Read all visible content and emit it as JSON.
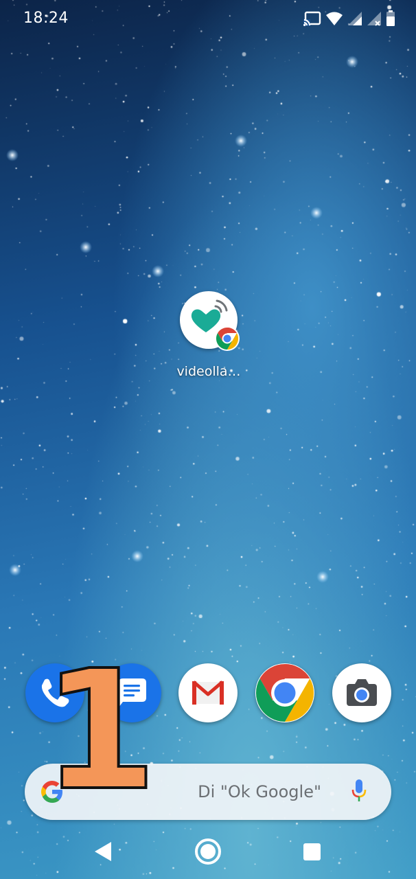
{
  "status_bar": {
    "time": "18:24",
    "icons": [
      "cast-icon",
      "wifi-icon",
      "signal-icon",
      "signal-no-service-icon",
      "battery-icon"
    ]
  },
  "home": {
    "app_shortcut": {
      "label": "videolla…",
      "icon": "heart-signal-icon",
      "badge": "chrome-badge-icon",
      "accent": "#1aab96"
    }
  },
  "dock": {
    "apps": [
      {
        "name": "Phone",
        "icon": "phone-icon",
        "color": "#1a73e8"
      },
      {
        "name": "Messages",
        "icon": "messages-icon",
        "color": "#1a73e8"
      },
      {
        "name": "Gmail",
        "icon": "gmail-icon",
        "color": "#d93025"
      },
      {
        "name": "Chrome",
        "icon": "chrome-icon",
        "color": "#1a73e8"
      },
      {
        "name": "Camera",
        "icon": "camera-icon",
        "color": "#4a4d51"
      }
    ]
  },
  "search_bar": {
    "hint": "Di \"Ok Google\"",
    "logo": "google-g-icon",
    "mic": "microphone-icon"
  },
  "overlay": {
    "number": "1",
    "color": "#f49658"
  },
  "nav_bar": {
    "buttons": [
      "back-icon",
      "home-icon",
      "recents-icon"
    ]
  }
}
